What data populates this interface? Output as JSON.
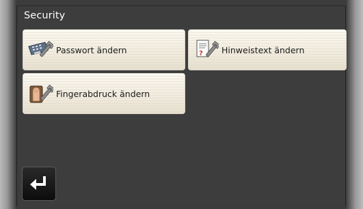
{
  "header": {
    "title": "Security"
  },
  "tiles": [
    {
      "label": "Passwort ändern",
      "icon": "keyboard-wrench-icon"
    },
    {
      "label": "Hinweistext ändern",
      "icon": "document-wrench-icon"
    },
    {
      "label": "Fingerabdruck ändern",
      "icon": "fingerprint-wrench-icon"
    }
  ],
  "footer": {
    "back_icon": "return-arrow-icon"
  },
  "colors": {
    "screen_background": "#3d3d3d",
    "tile_background": "#f1ecdf",
    "title_text": "#ffffff",
    "back_button": "#111111"
  }
}
